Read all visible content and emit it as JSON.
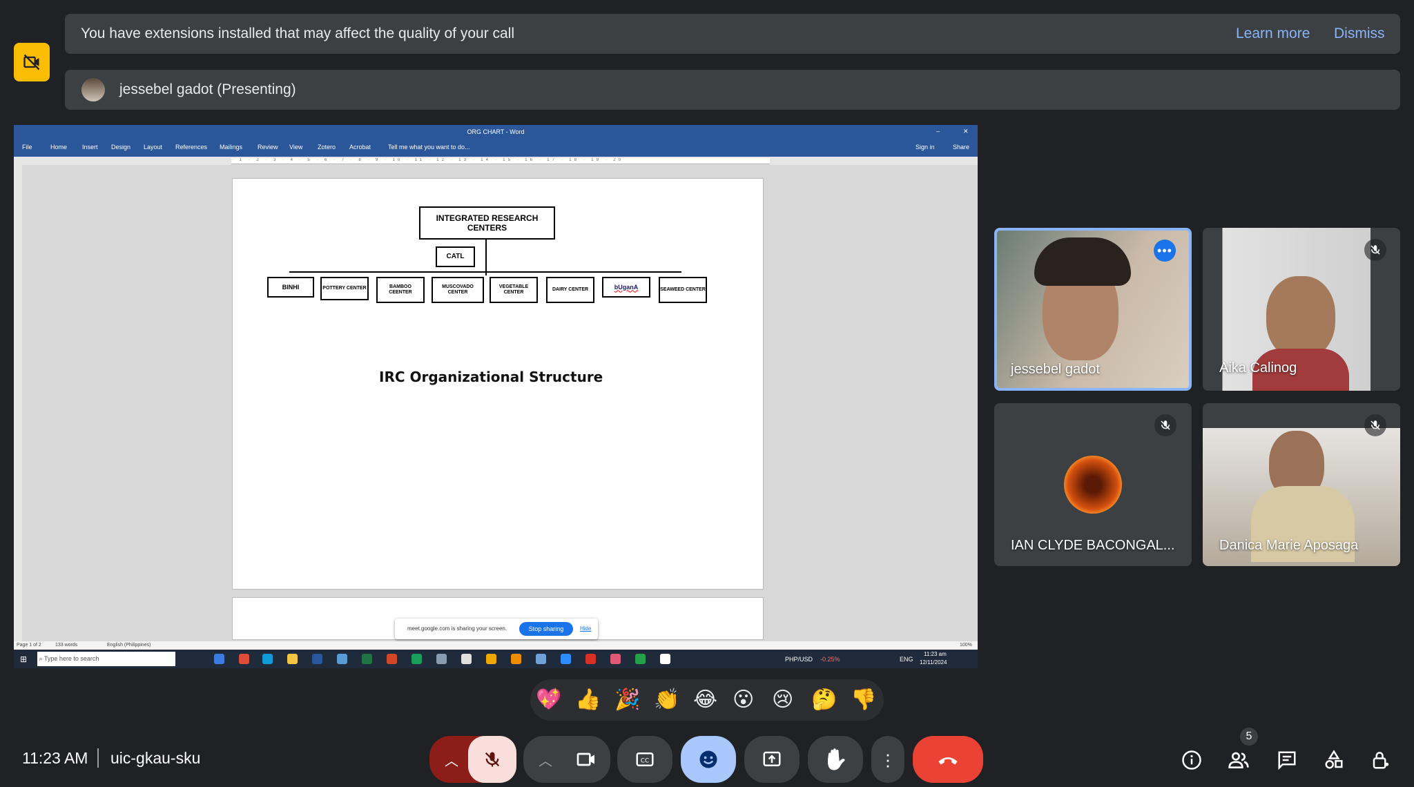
{
  "banner": {
    "message": "You have extensions installed that may affect the quality of your call",
    "learn_more": "Learn more",
    "dismiss": "Dismiss"
  },
  "presenter_bar": {
    "name": "jessebel gadot (Presenting)"
  },
  "word": {
    "title": "ORG CHART - Word",
    "tabs": [
      "File",
      "Home",
      "Insert",
      "Design",
      "Layout",
      "References",
      "Mailings",
      "Review",
      "View",
      "Zotero",
      "Acrobat"
    ],
    "tell_me": "Tell me what you want to do...",
    "sign_in": "Sign in",
    "share": "Share",
    "status": {
      "page": "Page 1 of 2",
      "words": "133 words",
      "language": "English (Philippines)",
      "zoom": "100%"
    }
  },
  "org_chart": {
    "root": "INTEGRATED RESEARCH CENTERS",
    "sub": "CATL",
    "children": [
      "BINHI",
      "POTTERY CENTER",
      "BAMBOO CEENTER",
      "MUSCOVADO CENTER",
      "VEGETABLE CENTER",
      "DAIRY CENTER",
      "bUganA",
      "SEAWEED CENTER"
    ],
    "title": "IRC Organizational Structure"
  },
  "share_popup": {
    "message": "meet.google.com is sharing your screen.",
    "stop": "Stop sharing",
    "hide": "Hide"
  },
  "taskbar": {
    "search_placeholder": "Type here to search",
    "ticker": "PHP/USD",
    "ticker_change": "-0.25%",
    "lang": "ENG",
    "time": "11:23 am",
    "date": "12/11/2024"
  },
  "participants": [
    {
      "name": "jessebel gadot"
    },
    {
      "name": "Aika Calinog"
    },
    {
      "name": "IAN CLYDE BACONGAL..."
    },
    {
      "name": "Danica Marie Aposaga"
    }
  ],
  "reactions": [
    "💖",
    "👍",
    "🎉",
    "👏",
    "😂",
    "😮",
    "😢",
    "🤔",
    "👎"
  ],
  "bottom": {
    "time": "11:23 AM",
    "meeting_code": "uic-gkau-sku",
    "participant_count": "5"
  },
  "colors": {
    "accent": "#8ab4f8",
    "end_call": "#ea4335",
    "mic_off": "#f9dedc",
    "active": "#a8c7fa",
    "warning": "#fbbc04"
  }
}
